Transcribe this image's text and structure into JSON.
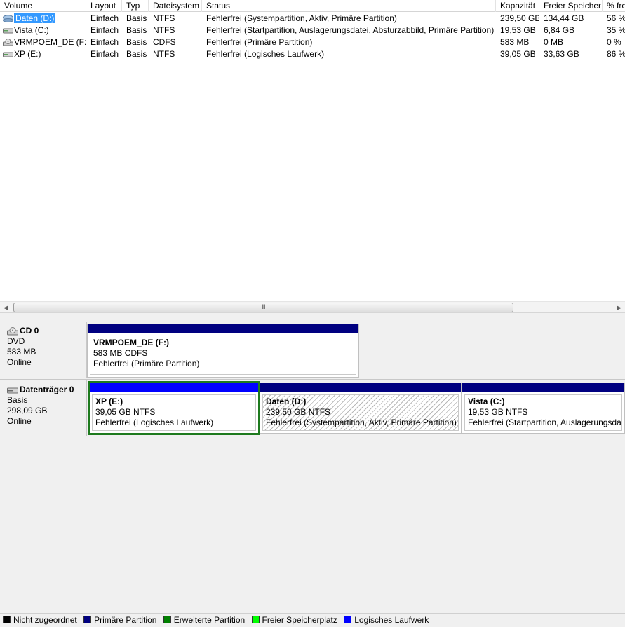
{
  "columns": [
    "Volume",
    "Layout",
    "Typ",
    "Dateisystem",
    "Status",
    "Kapazität",
    "Freier Speicher",
    "% frei"
  ],
  "volumes": [
    {
      "volume": "Daten (D:)",
      "layout": "Einfach",
      "type": "Basis",
      "fs": "NTFS",
      "status": "Fehlerfrei (Systempartition, Aktiv, Primäre Partition)",
      "capacity": "239,50 GB",
      "free": "134,44 GB",
      "pct": "56 %",
      "icon": "drive-icon",
      "selected": true
    },
    {
      "volume": "Vista (C:)",
      "layout": "Einfach",
      "type": "Basis",
      "fs": "NTFS",
      "status": "Fehlerfrei (Startpartition, Auslagerungsdatei, Absturzabbild, Primäre Partition)",
      "capacity": "19,53 GB",
      "free": "6,84 GB",
      "pct": "35 %",
      "icon": "drive-icon",
      "selected": false
    },
    {
      "volume": "VRMPOEM_DE (F:)",
      "layout": "Einfach",
      "type": "Basis",
      "fs": "CDFS",
      "status": "Fehlerfrei (Primäre Partition)",
      "capacity": "583 MB",
      "free": "0 MB",
      "pct": "0 %",
      "icon": "cd-drive-icon",
      "selected": false
    },
    {
      "volume": "XP (E:)",
      "layout": "Einfach",
      "type": "Basis",
      "fs": "NTFS",
      "status": "Fehlerfrei (Logisches Laufwerk)",
      "capacity": "39,05 GB",
      "free": "33,63 GB",
      "pct": "86 %",
      "icon": "drive-icon",
      "selected": false
    }
  ],
  "scrollbar": {
    "left_arrow": "◀",
    "right_arrow": "▶",
    "grip": "III"
  },
  "disks": [
    {
      "name": "CD 0",
      "kind": "DVD",
      "size": "583 MB",
      "state": "Online",
      "icon": "cd-disk-icon",
      "partitions": [
        {
          "name": "VRMPOEM_DE  (F:)",
          "detail": "583 MB CDFS",
          "status": "Fehlerfrei (Primäre Partition)",
          "bar_color": "#000080"
        }
      ]
    },
    {
      "name": "Datenträger 0",
      "kind": "Basis",
      "size": "298,09 GB",
      "state": "Online",
      "icon": "hard-disk-icon",
      "partitions": [
        {
          "name": "XP  (E:)",
          "detail": "39,05 GB NTFS",
          "status": "Fehlerfrei (Logisches Laufwerk)",
          "bar_color": "#0000ff"
        },
        {
          "name": "Daten  (D:)",
          "detail": "239,50 GB NTFS",
          "status": "Fehlerfrei (Systempartition, Aktiv, Primäre Partition)",
          "bar_color": "#000080"
        },
        {
          "name": "Vista  (C:)",
          "detail": "19,53 GB NTFS",
          "status": "Fehlerfrei (Startpartition, Auslagerungsdatei, Absturzabbild, Primäre Partition)",
          "bar_color": "#000080"
        }
      ]
    }
  ],
  "legend": [
    {
      "label": "Nicht zugeordnet",
      "color": "#000000"
    },
    {
      "label": "Primäre Partition",
      "color": "#000080"
    },
    {
      "label": "Erweiterte Partition",
      "color": "#008000"
    },
    {
      "label": "Freier Speicherplatz",
      "color": "#00ff00"
    },
    {
      "label": "Logisches Laufwerk",
      "color": "#0000ff"
    }
  ]
}
